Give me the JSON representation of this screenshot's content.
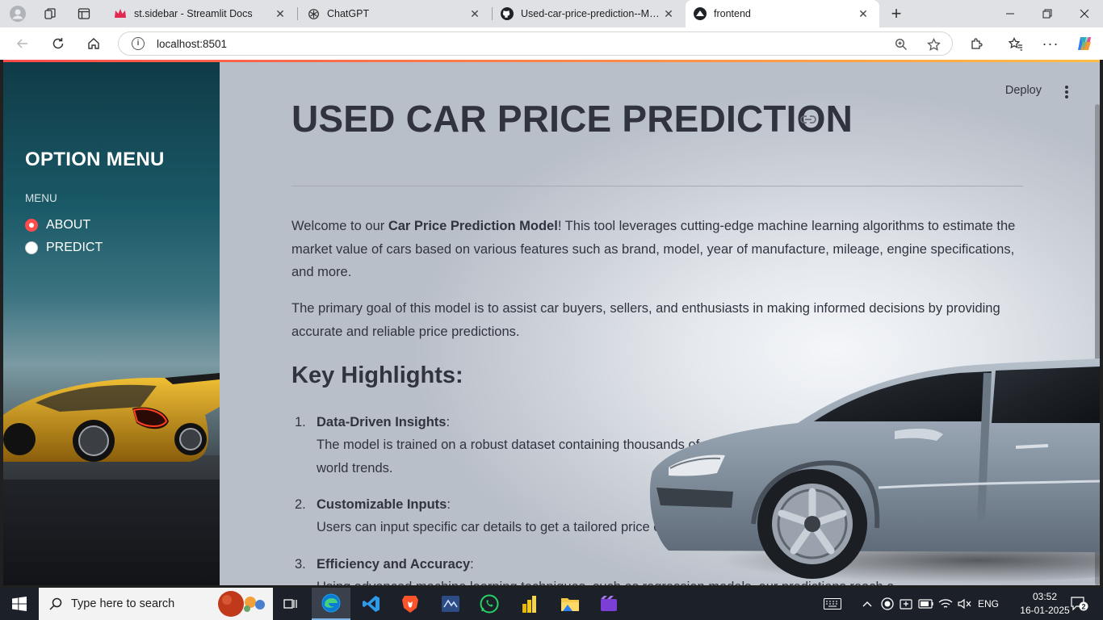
{
  "browser": {
    "tabs": [
      {
        "title": "st.sidebar - Streamlit Docs",
        "icon": "streamlit-crown-icon",
        "active": false
      },
      {
        "title": "ChatGPT",
        "icon": "chatgpt-icon",
        "active": false
      },
      {
        "title": "Used-car-price-prediction--ML/ a",
        "icon": "github-icon",
        "active": false
      },
      {
        "title": "frontend",
        "icon": "streamlit-icon",
        "active": true
      }
    ],
    "close_glyph": "✕",
    "new_tab_glyph": "+",
    "url": "localhost:8501"
  },
  "app": {
    "sidebar": {
      "title": "OPTION MENU",
      "menu_label": "MENU",
      "options": [
        {
          "label": "ABOUT",
          "selected": true
        },
        {
          "label": "PREDICT",
          "selected": false
        }
      ]
    },
    "header": {
      "deploy_label": "Deploy"
    },
    "main": {
      "title": "USED CAR PRICE PREDICTION",
      "intro": {
        "prefix": "Welcome to our ",
        "bold": "Car Price Prediction Model",
        "suffix": "! This tool leverages cutting-edge machine learning algorithms to estimate the market value of cars based on various features such as brand, model, year of manufacture, mileage, engine specifications, and more."
      },
      "goal": "The primary goal of this model is to assist car buyers, sellers, and enthusiasts in making informed decisions by providing accurate and reliable price predictions.",
      "highlights_heading": "Key Highlights:",
      "highlights": [
        {
          "num": "1.",
          "title": "Data-Driven Insights",
          "text": "The model is trained on a robust dataset containing thousands of car listings, ensuring predictions are grounded in real-world trends."
        },
        {
          "num": "2.",
          "title": "Customizable Inputs",
          "text": "Users can input specific car details to get a tailored price estimate."
        },
        {
          "num": "3.",
          "title": "Efficiency and Accuracy",
          "text": "Using advanced machine learning techniques, such as regression models, our predictions reach a ..."
        }
      ]
    }
  },
  "taskbar": {
    "search_placeholder": "Type here to search",
    "language": "ENG",
    "time": "03:52",
    "date": "16-01-2025"
  },
  "colors": {
    "accent": "#ff4b4b",
    "text": "#31333f",
    "sidebar_title": "#ffffff"
  }
}
